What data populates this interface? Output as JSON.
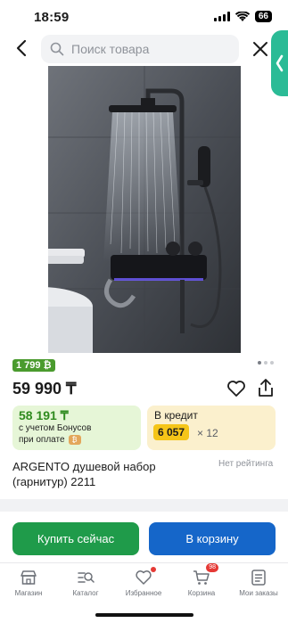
{
  "status_bar": {
    "time": "18:59",
    "battery": "66"
  },
  "search": {
    "placeholder": "Поиск товара"
  },
  "product": {
    "badge": "1 799 ₿",
    "price": "59 990 ₸",
    "title": "ARGENTO душевой набор (гарнитур) 2211",
    "rating_text": "Нет рейтинга",
    "image_dots": 3
  },
  "bonus_card": {
    "amount": "58 191 ₸",
    "line1": "с учетом Бонусов",
    "line2": "при оплате"
  },
  "credit_card": {
    "label": "В кредит",
    "monthly": "6 057",
    "months": "× 12"
  },
  "buttons": {
    "buy_now": "Купить сейчас",
    "add_to_cart": "В корзину"
  },
  "tabbar": {
    "items": [
      {
        "label": "Магазин",
        "icon": "shop-icon"
      },
      {
        "label": "Каталог",
        "icon": "catalog-icon"
      },
      {
        "label": "Избранное",
        "icon": "heart-icon"
      },
      {
        "label": "Корзина",
        "icon": "cart-icon",
        "badge": "98"
      },
      {
        "label": "Мои заказы",
        "icon": "orders-icon"
      }
    ]
  },
  "colors": {
    "buy": "#1f9b4a",
    "cart": "#1566c9",
    "bonus_bg": "#e6f6d7",
    "credit_bg": "#fbf0cd",
    "badge": "#4a9b2e",
    "accent_tab": "#2bbb96"
  }
}
